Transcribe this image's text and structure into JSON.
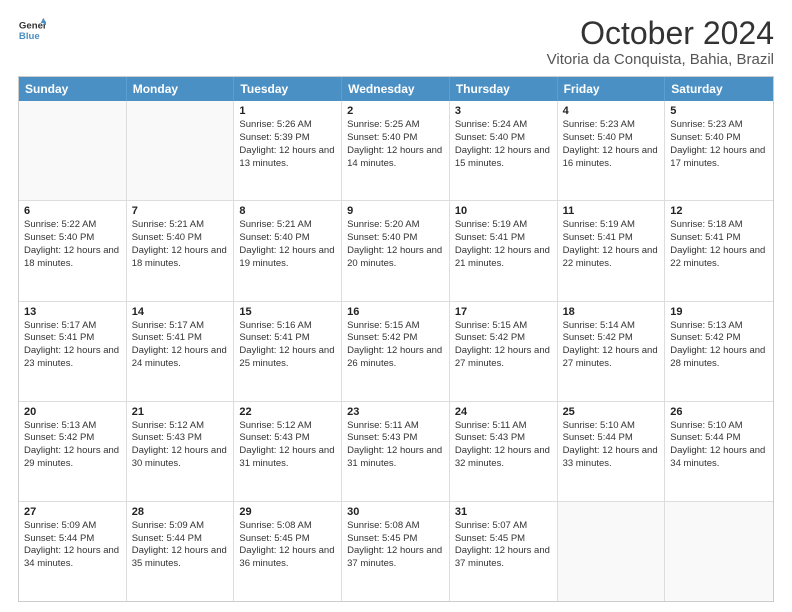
{
  "logo": {
    "line1": "General",
    "line2": "Blue"
  },
  "title": "October 2024",
  "subtitle": "Vitoria da Conquista, Bahia, Brazil",
  "header_days": [
    "Sunday",
    "Monday",
    "Tuesday",
    "Wednesday",
    "Thursday",
    "Friday",
    "Saturday"
  ],
  "weeks": [
    [
      {
        "day": "",
        "sunrise": "",
        "sunset": "",
        "daylight": "",
        "empty": true
      },
      {
        "day": "",
        "sunrise": "",
        "sunset": "",
        "daylight": "",
        "empty": true
      },
      {
        "day": "1",
        "sunrise": "Sunrise: 5:26 AM",
        "sunset": "Sunset: 5:39 PM",
        "daylight": "Daylight: 12 hours and 13 minutes."
      },
      {
        "day": "2",
        "sunrise": "Sunrise: 5:25 AM",
        "sunset": "Sunset: 5:40 PM",
        "daylight": "Daylight: 12 hours and 14 minutes."
      },
      {
        "day": "3",
        "sunrise": "Sunrise: 5:24 AM",
        "sunset": "Sunset: 5:40 PM",
        "daylight": "Daylight: 12 hours and 15 minutes."
      },
      {
        "day": "4",
        "sunrise": "Sunrise: 5:23 AM",
        "sunset": "Sunset: 5:40 PM",
        "daylight": "Daylight: 12 hours and 16 minutes."
      },
      {
        "day": "5",
        "sunrise": "Sunrise: 5:23 AM",
        "sunset": "Sunset: 5:40 PM",
        "daylight": "Daylight: 12 hours and 17 minutes."
      }
    ],
    [
      {
        "day": "6",
        "sunrise": "Sunrise: 5:22 AM",
        "sunset": "Sunset: 5:40 PM",
        "daylight": "Daylight: 12 hours and 18 minutes."
      },
      {
        "day": "7",
        "sunrise": "Sunrise: 5:21 AM",
        "sunset": "Sunset: 5:40 PM",
        "daylight": "Daylight: 12 hours and 18 minutes."
      },
      {
        "day": "8",
        "sunrise": "Sunrise: 5:21 AM",
        "sunset": "Sunset: 5:40 PM",
        "daylight": "Daylight: 12 hours and 19 minutes."
      },
      {
        "day": "9",
        "sunrise": "Sunrise: 5:20 AM",
        "sunset": "Sunset: 5:40 PM",
        "daylight": "Daylight: 12 hours and 20 minutes."
      },
      {
        "day": "10",
        "sunrise": "Sunrise: 5:19 AM",
        "sunset": "Sunset: 5:41 PM",
        "daylight": "Daylight: 12 hours and 21 minutes."
      },
      {
        "day": "11",
        "sunrise": "Sunrise: 5:19 AM",
        "sunset": "Sunset: 5:41 PM",
        "daylight": "Daylight: 12 hours and 22 minutes."
      },
      {
        "day": "12",
        "sunrise": "Sunrise: 5:18 AM",
        "sunset": "Sunset: 5:41 PM",
        "daylight": "Daylight: 12 hours and 22 minutes."
      }
    ],
    [
      {
        "day": "13",
        "sunrise": "Sunrise: 5:17 AM",
        "sunset": "Sunset: 5:41 PM",
        "daylight": "Daylight: 12 hours and 23 minutes."
      },
      {
        "day": "14",
        "sunrise": "Sunrise: 5:17 AM",
        "sunset": "Sunset: 5:41 PM",
        "daylight": "Daylight: 12 hours and 24 minutes."
      },
      {
        "day": "15",
        "sunrise": "Sunrise: 5:16 AM",
        "sunset": "Sunset: 5:41 PM",
        "daylight": "Daylight: 12 hours and 25 minutes."
      },
      {
        "day": "16",
        "sunrise": "Sunrise: 5:15 AM",
        "sunset": "Sunset: 5:42 PM",
        "daylight": "Daylight: 12 hours and 26 minutes."
      },
      {
        "day": "17",
        "sunrise": "Sunrise: 5:15 AM",
        "sunset": "Sunset: 5:42 PM",
        "daylight": "Daylight: 12 hours and 27 minutes."
      },
      {
        "day": "18",
        "sunrise": "Sunrise: 5:14 AM",
        "sunset": "Sunset: 5:42 PM",
        "daylight": "Daylight: 12 hours and 27 minutes."
      },
      {
        "day": "19",
        "sunrise": "Sunrise: 5:13 AM",
        "sunset": "Sunset: 5:42 PM",
        "daylight": "Daylight: 12 hours and 28 minutes."
      }
    ],
    [
      {
        "day": "20",
        "sunrise": "Sunrise: 5:13 AM",
        "sunset": "Sunset: 5:42 PM",
        "daylight": "Daylight: 12 hours and 29 minutes."
      },
      {
        "day": "21",
        "sunrise": "Sunrise: 5:12 AM",
        "sunset": "Sunset: 5:43 PM",
        "daylight": "Daylight: 12 hours and 30 minutes."
      },
      {
        "day": "22",
        "sunrise": "Sunrise: 5:12 AM",
        "sunset": "Sunset: 5:43 PM",
        "daylight": "Daylight: 12 hours and 31 minutes."
      },
      {
        "day": "23",
        "sunrise": "Sunrise: 5:11 AM",
        "sunset": "Sunset: 5:43 PM",
        "daylight": "Daylight: 12 hours and 31 minutes."
      },
      {
        "day": "24",
        "sunrise": "Sunrise: 5:11 AM",
        "sunset": "Sunset: 5:43 PM",
        "daylight": "Daylight: 12 hours and 32 minutes."
      },
      {
        "day": "25",
        "sunrise": "Sunrise: 5:10 AM",
        "sunset": "Sunset: 5:44 PM",
        "daylight": "Daylight: 12 hours and 33 minutes."
      },
      {
        "day": "26",
        "sunrise": "Sunrise: 5:10 AM",
        "sunset": "Sunset: 5:44 PM",
        "daylight": "Daylight: 12 hours and 34 minutes."
      }
    ],
    [
      {
        "day": "27",
        "sunrise": "Sunrise: 5:09 AM",
        "sunset": "Sunset: 5:44 PM",
        "daylight": "Daylight: 12 hours and 34 minutes."
      },
      {
        "day": "28",
        "sunrise": "Sunrise: 5:09 AM",
        "sunset": "Sunset: 5:44 PM",
        "daylight": "Daylight: 12 hours and 35 minutes."
      },
      {
        "day": "29",
        "sunrise": "Sunrise: 5:08 AM",
        "sunset": "Sunset: 5:45 PM",
        "daylight": "Daylight: 12 hours and 36 minutes."
      },
      {
        "day": "30",
        "sunrise": "Sunrise: 5:08 AM",
        "sunset": "Sunset: 5:45 PM",
        "daylight": "Daylight: 12 hours and 37 minutes."
      },
      {
        "day": "31",
        "sunrise": "Sunrise: 5:07 AM",
        "sunset": "Sunset: 5:45 PM",
        "daylight": "Daylight: 12 hours and 37 minutes."
      },
      {
        "day": "",
        "sunrise": "",
        "sunset": "",
        "daylight": "",
        "empty": true
      },
      {
        "day": "",
        "sunrise": "",
        "sunset": "",
        "daylight": "",
        "empty": true
      }
    ]
  ]
}
